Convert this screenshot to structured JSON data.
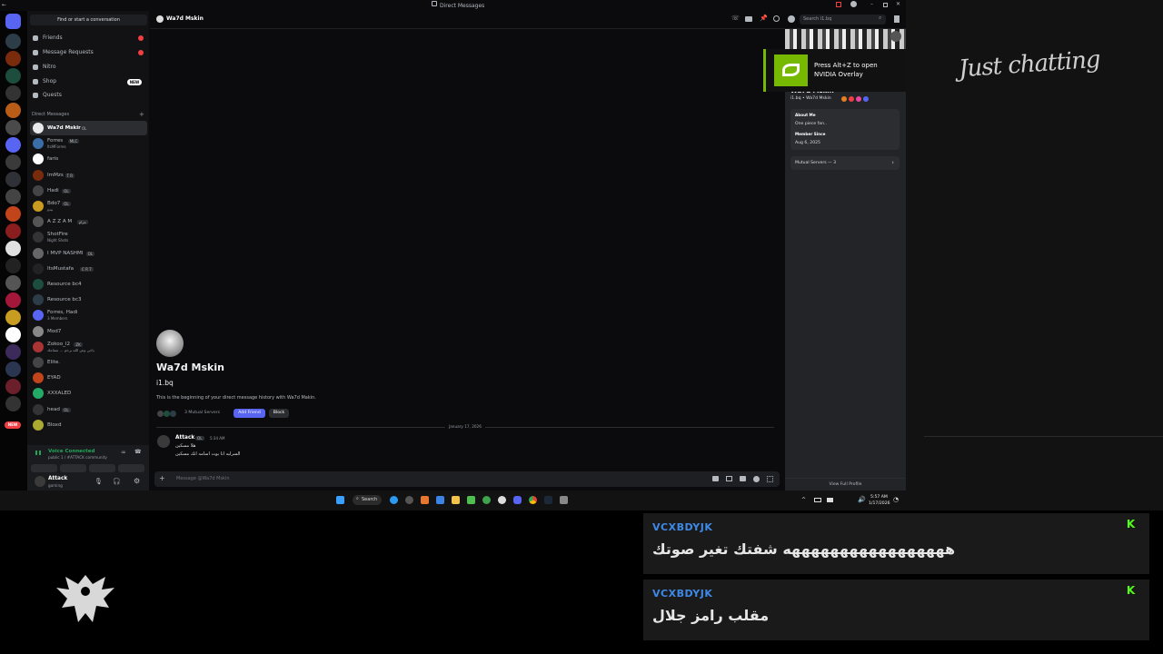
{
  "window": {
    "title": "Direct Messages"
  },
  "dm_sidebar": {
    "find_placeholder": "Find or start a conversation",
    "nav": [
      {
        "label": "Friends",
        "badge": true
      },
      {
        "label": "Message Requests",
        "badge": true
      },
      {
        "label": "Nitro",
        "badge": false
      },
      {
        "label": "Shop",
        "tag": "NEW"
      },
      {
        "label": "Quests",
        "badge": false
      }
    ],
    "section_label": "Direct Messages",
    "add_dm": "+",
    "dms": [
      {
        "name": "Wa7d Mskin",
        "tag": "OL",
        "sub": ""
      },
      {
        "name": "Forres",
        "tag": "MLC",
        "sub": "ItsMForres"
      },
      {
        "name": "faris",
        "tag": "",
        "sub": ""
      },
      {
        "name": "ImMzs",
        "tag": "T R",
        "sub": ""
      },
      {
        "name": "Hadi",
        "tag": "OL",
        "sub": ""
      },
      {
        "name": "Bdo7",
        "tag": "OL",
        "sub": "بيدو"
      },
      {
        "name": "A Z Z A M",
        "tag": "عزام",
        "sub": ""
      },
      {
        "name": "ShotFire",
        "tag": "",
        "sub": "Night Shots"
      },
      {
        "name": "I MVP NASHMI",
        "tag": "OL",
        "sub": ""
      },
      {
        "name": "ItsMustafa",
        "tag": "C R 7",
        "sub": ""
      },
      {
        "name": "Resource bc4",
        "tag": "",
        "sub": ""
      },
      {
        "name": "Resource bc3",
        "tag": "",
        "sub": ""
      },
      {
        "name": "Forres, Hadi",
        "tag": "",
        "sub": "3 Members"
      },
      {
        "name": "Mod7",
        "tag": "",
        "sub": ""
      },
      {
        "name": "Zokoo_l2",
        "tag": "ZK",
        "sub": "ياخي وش الله يرحم ... شقاعك"
      },
      {
        "name": "Elite.",
        "tag": "",
        "sub": ""
      },
      {
        "name": "EYAD",
        "tag": "",
        "sub": ""
      },
      {
        "name": "XXXALED",
        "tag": "",
        "sub": ""
      },
      {
        "name": "head",
        "tag": "OL",
        "sub": ""
      },
      {
        "name": "Bloxd",
        "tag": "",
        "sub": ""
      }
    ],
    "voice": {
      "status": "Voice Connected",
      "channel": "public 1 / #ATTACK community"
    },
    "user": {
      "name": "Attack",
      "status": "gaming"
    }
  },
  "chat": {
    "recipient": "Wa7d Mskin",
    "search_placeholder": "Search i1.bq",
    "welcome_name": "Wa7d Mskin",
    "welcome_username": "i1.bq",
    "welcome_text": "This is the beginning of your direct message history with Wa7d Makin.",
    "mutual_servers": "3 Mutual Servers",
    "add_friend": "Add Friend",
    "block": "Block",
    "date_divider": "January 17, 2026",
    "message": {
      "author": "Attack",
      "tag": "OL",
      "time": "5:34 AM",
      "line1": "هلا مسكين",
      "line2": "السرلبه انا بوت اسامه انك مسكين"
    },
    "input_placeholder": "Message @Wa7d Mskin"
  },
  "profile": {
    "name": "Wa7d Mskin",
    "username": "i1.bq • Wa7d Mskin",
    "about_title": "About Me",
    "about_text": "One piece fan..",
    "member_title": "Member Since",
    "member_date": "Aug 6, 2025",
    "mutual": "Mutual Servers — 3",
    "view_full": "View Full Profile"
  },
  "nvidia": {
    "text": "Press Alt+Z to open NVIDIA Overlay"
  },
  "taskbar": {
    "search": "Search",
    "time": "5:57 AM",
    "date": "1/17/2026"
  },
  "stream": {
    "overlay_title": "Just chatting",
    "messages": [
      {
        "user": "VCXBDYJK",
        "text": "هههههههههههههههههه شفتك تغير صوتك"
      },
      {
        "user": "VCXBDYJK",
        "text": "مقلب رامز جلال"
      }
    ]
  },
  "colors": {
    "accent": "#5865f2",
    "kick": "#53fc18",
    "chat_user": "#3f89e6",
    "voice": "#23a55a"
  }
}
